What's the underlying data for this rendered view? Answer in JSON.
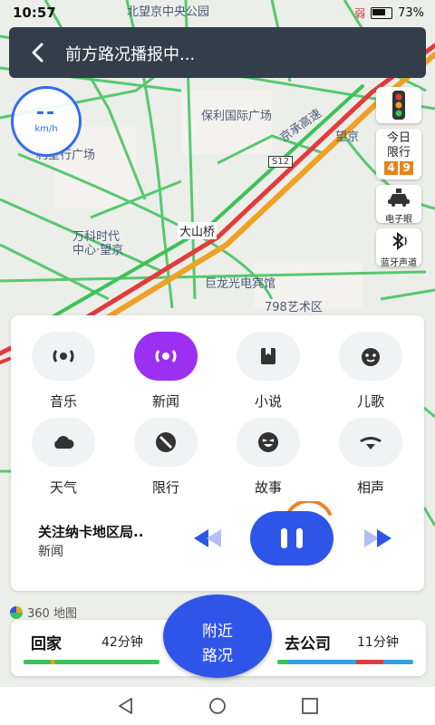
{
  "status_bar": {
    "time": "10:57",
    "signal": "弱",
    "battery": "73%"
  },
  "header": {
    "title": "前方路况播报中..."
  },
  "speedometer": {
    "value": "--",
    "unit": "km/h"
  },
  "side_controls": {
    "limit": {
      "title_line1": "今日",
      "title_line2": "限行",
      "digits": [
        "4",
        "9"
      ]
    },
    "eye_label": "电子眼",
    "bluetooth_label": "蓝牙声道"
  },
  "map_labels": {
    "top": "北望京中央公园",
    "baoli": "保利国际广场",
    "expressway": "京承高速",
    "lixing": "利星行广场",
    "s12": "S12",
    "wanke1": "万科时代",
    "wanke2": "中心·望京",
    "dashanzi": "大山桥",
    "julong": "巨龙光电宾馆",
    "art798": "798艺术区",
    "wangjing": "望京",
    "gong": "公"
  },
  "categories": [
    {
      "label": "音乐",
      "icon": "radio-wave-icon"
    },
    {
      "label": "新闻",
      "icon": "radio-wave-icon"
    },
    {
      "label": "小说",
      "icon": "book-icon"
    },
    {
      "label": "儿歌",
      "icon": "kid-face-icon"
    },
    {
      "label": "天气",
      "icon": "cloud-icon"
    },
    {
      "label": "限行",
      "icon": "no-entry-icon"
    },
    {
      "label": "故事",
      "icon": "laugh-face-icon"
    },
    {
      "label": "相声",
      "icon": "mustache-icon"
    }
  ],
  "player": {
    "title": "关注纳卡地区局..",
    "category": "新闻"
  },
  "logo": {
    "text": "360 地图"
  },
  "bottom": {
    "home": {
      "label": "回家",
      "time": "42分钟"
    },
    "work": {
      "label": "去公司",
      "time": "11分钟"
    },
    "nearby": {
      "line1": "附近",
      "line2": "路况"
    }
  },
  "colors": {
    "accent": "#2f55e8",
    "active_category": "#9b2ff2",
    "traffic_green": "#3cc25a",
    "traffic_red": "#e23b3b",
    "traffic_orange": "#f0a022"
  }
}
